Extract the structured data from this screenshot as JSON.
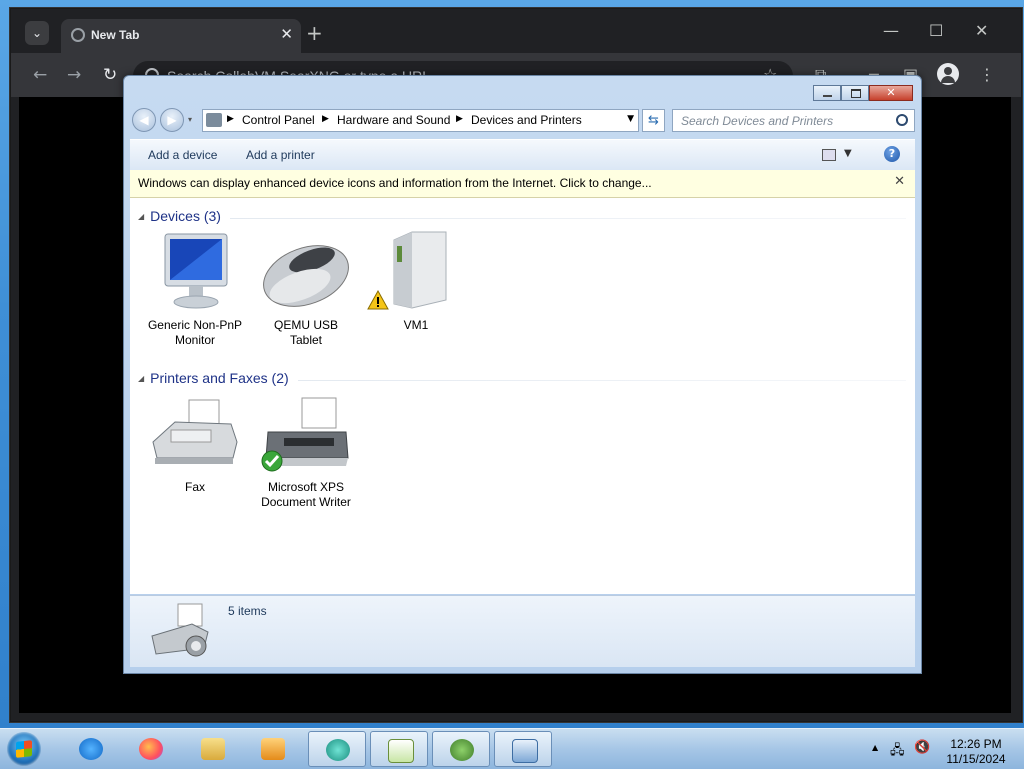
{
  "browser": {
    "tab_title": "New Tab",
    "new_tab": "+",
    "omnibox_text": "Search CollabVM SearXNG or type a URL",
    "window_controls": {
      "minimize": "—",
      "maximize": "☐",
      "close": "✕"
    },
    "nav": {
      "back": "←",
      "forward": "→",
      "reload": "↻"
    },
    "toolbar_icons": [
      "extensions-icon",
      "pin-icon",
      "tab-search-icon",
      "profile-icon",
      "menu-icon"
    ]
  },
  "explorer": {
    "address": {
      "crumbs": [
        "Control Panel",
        "Hardware and Sound",
        "Devices and Printers"
      ]
    },
    "search_placeholder": "Search Devices and Printers",
    "commands": {
      "add_device": "Add a device",
      "add_printer": "Add a printer"
    },
    "infobar": "Windows can display enhanced device icons and information from the Internet. Click to change...",
    "groups": [
      {
        "title": "Devices (3)",
        "items": [
          {
            "label_line1": "Generic Non-PnP",
            "label_line2": "Monitor",
            "icon": "monitor-icon"
          },
          {
            "label_line1": "QEMU USB",
            "label_line2": "Tablet",
            "icon": "mouse-icon"
          },
          {
            "label_line1": "VM1",
            "label_line2": "",
            "icon": "computer-tower-icon",
            "warning": true
          }
        ]
      },
      {
        "title": "Printers and Faxes (2)",
        "items": [
          {
            "label_line1": "Fax",
            "label_line2": "",
            "icon": "fax-icon"
          },
          {
            "label_line1": "Microsoft XPS",
            "label_line2": "Document Writer",
            "icon": "printer-icon",
            "default": true
          }
        ]
      }
    ],
    "status": {
      "count": "5 items"
    }
  },
  "taskbar": {
    "apps": [
      "internet-explorer-icon",
      "firefox-icon",
      "file-explorer-icon",
      "media-player-icon",
      "app-icon",
      "notepad-icon",
      "frog-app-icon",
      "devices-printers-icon"
    ],
    "clock": {
      "time": "12:26 PM",
      "date": "11/15/2024"
    }
  },
  "colors": {
    "chrome_frame": "#202124",
    "chrome_toolbar": "#35363a",
    "explorer_frame": "#c6daf1",
    "infobar": "#ffffe1",
    "group_title": "#1e3287"
  }
}
